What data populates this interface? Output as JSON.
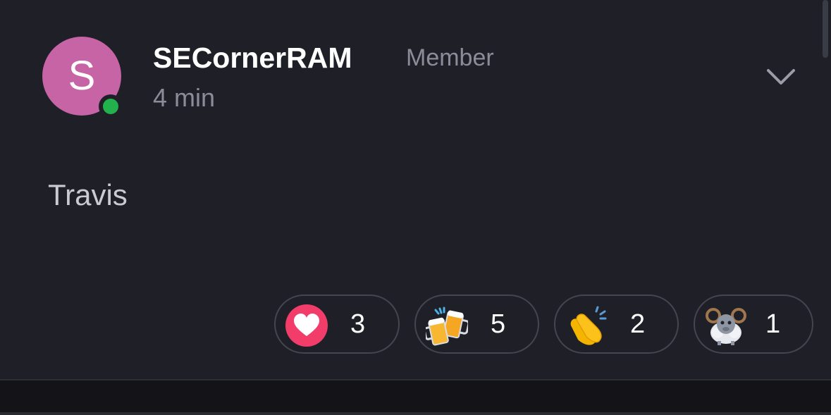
{
  "post": {
    "author": {
      "avatar_initial": "S",
      "avatar_color": "#c764a6",
      "name": "SECornerRAM",
      "role": "Member",
      "online": true,
      "presence_color": "#23b14d"
    },
    "timestamp": "4 min",
    "menu_icon": "chevron-down-icon",
    "body": "Travis"
  },
  "reactions": [
    {
      "emoji": "red-heart",
      "count": "3"
    },
    {
      "emoji": "clinking-beer-mugs",
      "count": "5"
    },
    {
      "emoji": "clapping-hands",
      "count": "2"
    },
    {
      "emoji": "ram",
      "count": "1"
    }
  ],
  "colors": {
    "background": "#1f2027",
    "text_primary": "#ffffff",
    "text_muted": "#8a8d99",
    "pill_border": "#43454f"
  }
}
